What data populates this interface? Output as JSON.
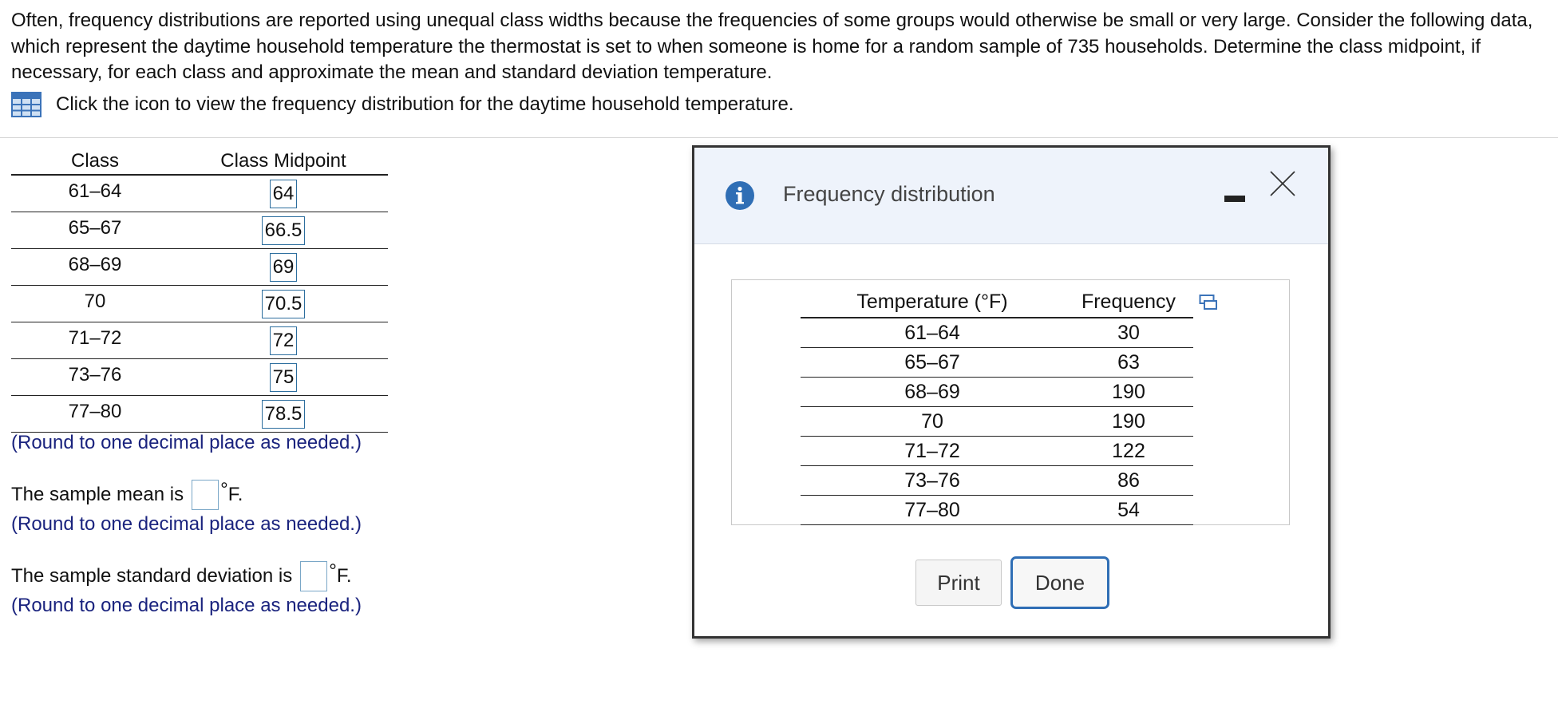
{
  "question": {
    "text": "Often, frequency distributions are reported using unequal class widths because the frequencies of some groups would otherwise be small or very large. Consider the following data, which represent the daytime household temperature the thermostat is set to when someone is home for a random sample of 735 households. Determine the class midpoint, if necessary, for each class and approximate the mean and standard deviation temperature.",
    "hint": "Click the icon to view the frequency distribution for the daytime household temperature."
  },
  "answer_table": {
    "headers": {
      "class": "Class",
      "midpoint": "Class Midpoint"
    },
    "rows": [
      {
        "class": "61–64",
        "midpoint": "64"
      },
      {
        "class": "65–67",
        "midpoint": "66.5"
      },
      {
        "class": "68–69",
        "midpoint": "69"
      },
      {
        "class": "70",
        "midpoint": "70.5"
      },
      {
        "class": "71–72",
        "midpoint": "72"
      },
      {
        "class": "73–76",
        "midpoint": "75"
      },
      {
        "class": "77–80",
        "midpoint": "78.5"
      }
    ]
  },
  "round_note": "(Round to one decimal place as needed.)",
  "mean": {
    "prefix": "The sample mean is",
    "degree": "°",
    "unit": "F."
  },
  "sd": {
    "prefix": "The sample standard deviation is",
    "degree": "°",
    "unit": "F."
  },
  "dialog": {
    "title": "Frequency distribution",
    "table": {
      "headers": {
        "temperature": "Temperature (°F)",
        "frequency": "Frequency"
      },
      "rows": [
        {
          "temp": "61–64",
          "freq": "30"
        },
        {
          "temp": "65–67",
          "freq": "63"
        },
        {
          "temp": "68–69",
          "freq": "190"
        },
        {
          "temp": "70",
          "freq": "190"
        },
        {
          "temp": "71–72",
          "freq": "122"
        },
        {
          "temp": "73–76",
          "freq": "86"
        },
        {
          "temp": "77–80",
          "freq": "54"
        }
      ]
    },
    "print_label": "Print",
    "done_label": "Done"
  },
  "colors": {
    "accent_blue": "#2f6eb5",
    "hint_navy": "#1a237e",
    "header_bg": "#eef3fb"
  }
}
